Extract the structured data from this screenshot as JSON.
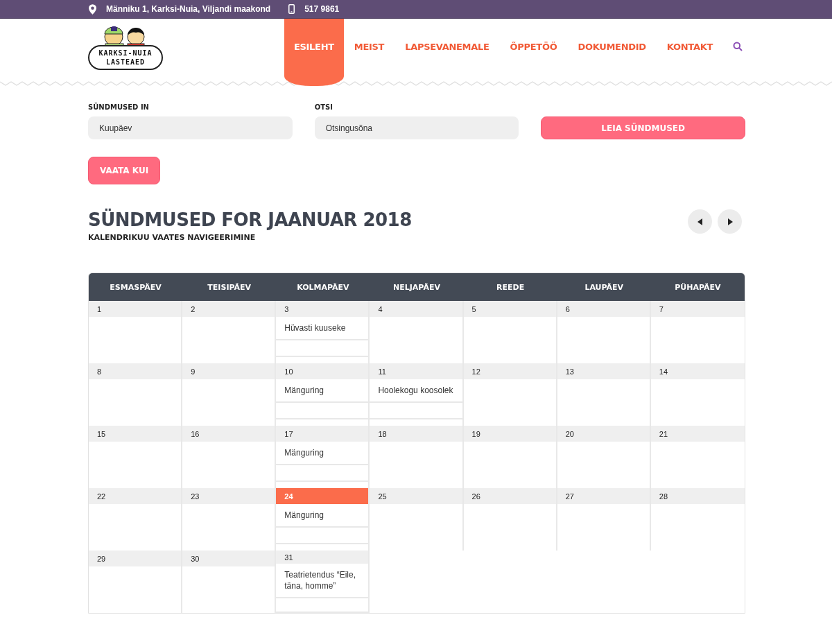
{
  "top_bar": {
    "address": "Männiku 1, Karksi-Nuia, Viljandi maakond",
    "phone": "517 9861"
  },
  "logo": {
    "line_1": "KARKSI-NUIA",
    "line_2": "LASTEAED"
  },
  "nav": [
    {
      "label": "ESILEHT",
      "selected": true
    },
    {
      "label": "MEIST",
      "selected": false
    },
    {
      "label": "LAPSEVANEMALE",
      "selected": false
    },
    {
      "label": "ÕPPETÖÖ",
      "selected": false
    },
    {
      "label": "DOKUMENDID",
      "selected": false
    },
    {
      "label": "KONTAKT",
      "selected": false
    }
  ],
  "filters": {
    "date_label": "SÜNDMUSED IN",
    "date_placeholder": "Kuupäev",
    "search_label": "OTSI",
    "search_placeholder": "Otsingusõna",
    "find_button": "LEIA SÜNDMUSED",
    "view_button": "VAATA KUI"
  },
  "heading": {
    "title": "SÜNDMUSED FOR JAANUAR 2018",
    "subtitle": "KALENDRIKUU VAATES NAVIGEERIMINE"
  },
  "calendar": {
    "columns": [
      "ESMASPÄEV",
      "TEISIPÄEV",
      "KOLMAPÄEV",
      "NELJAPÄEV",
      "REEDE",
      "LAUPÄEV",
      "PÜHAPÄEV"
    ],
    "weeks": [
      {
        "days": [
          {
            "number": "1",
            "today": false
          },
          {
            "number": "2",
            "today": false
          },
          {
            "number": "3",
            "today": false,
            "events": [
              "Hüvasti kuuseke"
            ]
          },
          {
            "number": "4",
            "today": false
          },
          {
            "number": "5",
            "today": false
          },
          {
            "number": "6",
            "today": false
          },
          {
            "number": "7",
            "today": false
          }
        ]
      },
      {
        "days": [
          {
            "number": "8",
            "today": false
          },
          {
            "number": "9",
            "today": false
          },
          {
            "number": "10",
            "today": false,
            "events": [
              "Mänguring"
            ]
          },
          {
            "number": "11",
            "today": false,
            "events": [
              "Hoolekogu koosolek"
            ]
          },
          {
            "number": "12",
            "today": false
          },
          {
            "number": "13",
            "today": false
          },
          {
            "number": "14",
            "today": false
          }
        ]
      },
      {
        "days": [
          {
            "number": "15",
            "today": false
          },
          {
            "number": "16",
            "today": false
          },
          {
            "number": "17",
            "today": false,
            "events": [
              "Mänguring"
            ]
          },
          {
            "number": "18",
            "today": false
          },
          {
            "number": "19",
            "today": false
          },
          {
            "number": "20",
            "today": false
          },
          {
            "number": "21",
            "today": false
          }
        ]
      },
      {
        "days": [
          {
            "number": "22",
            "today": false
          },
          {
            "number": "23",
            "today": false
          },
          {
            "number": "24",
            "today": true,
            "events": [
              "Mänguring"
            ]
          },
          {
            "number": "25",
            "today": false
          },
          {
            "number": "26",
            "today": false
          },
          {
            "number": "27",
            "today": false
          },
          {
            "number": "28",
            "today": false
          }
        ]
      },
      {
        "days": [
          {
            "number": "29",
            "today": false
          },
          {
            "number": "30",
            "today": false
          },
          {
            "number": "31",
            "today": false,
            "events": [
              "Teatrietendus “Eile, täna, homme”"
            ]
          }
        ]
      }
    ]
  }
}
